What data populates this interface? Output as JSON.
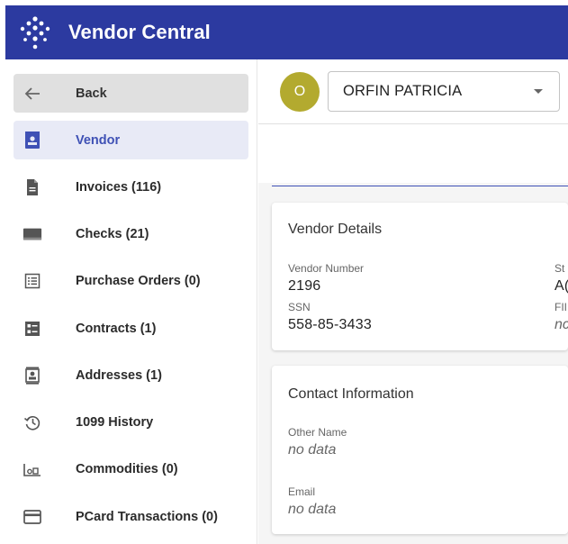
{
  "app": {
    "title": "Vendor Central"
  },
  "sidebar": {
    "items": [
      {
        "label": "Back",
        "icon": "arrow-left-icon"
      },
      {
        "label": "Vendor",
        "icon": "vendor-card-icon"
      },
      {
        "label": "Invoices (116)",
        "icon": "document-icon"
      },
      {
        "label": "Checks (21)",
        "icon": "check-icon"
      },
      {
        "label": "Purchase Orders (0)",
        "icon": "list-icon"
      },
      {
        "label": "Contracts (1)",
        "icon": "contract-icon"
      },
      {
        "label": "Addresses (1)",
        "icon": "address-card-icon"
      },
      {
        "label": "1099 History",
        "icon": "history-icon"
      },
      {
        "label": "Commodities (0)",
        "icon": "commodities-icon"
      },
      {
        "label": "PCard Transactions (0)",
        "icon": "credit-card-icon"
      }
    ],
    "active_index": 1
  },
  "vendor_header": {
    "avatar_letter": "O",
    "selected_vendor": "ORFIN PATRICIA"
  },
  "vendor_details": {
    "title": "Vendor Details",
    "vendor_number_label": "Vendor Number",
    "vendor_number": "2196",
    "ssn_label": "SSN",
    "ssn": "558-85-3433",
    "status_label_partial": "St",
    "status_value_partial": "A(",
    "fein_label_partial": "FII",
    "fein_value_partial": "nc"
  },
  "contact_info": {
    "title": "Contact Information",
    "other_name_label": "Other Name",
    "other_name": "no data",
    "email_label": "Email",
    "email": "no data"
  },
  "colors": {
    "topbar": "#2c3aa0",
    "accent": "#3f51b5",
    "active_bg": "#e8eaf6",
    "avatar": "#b3aa2f"
  }
}
